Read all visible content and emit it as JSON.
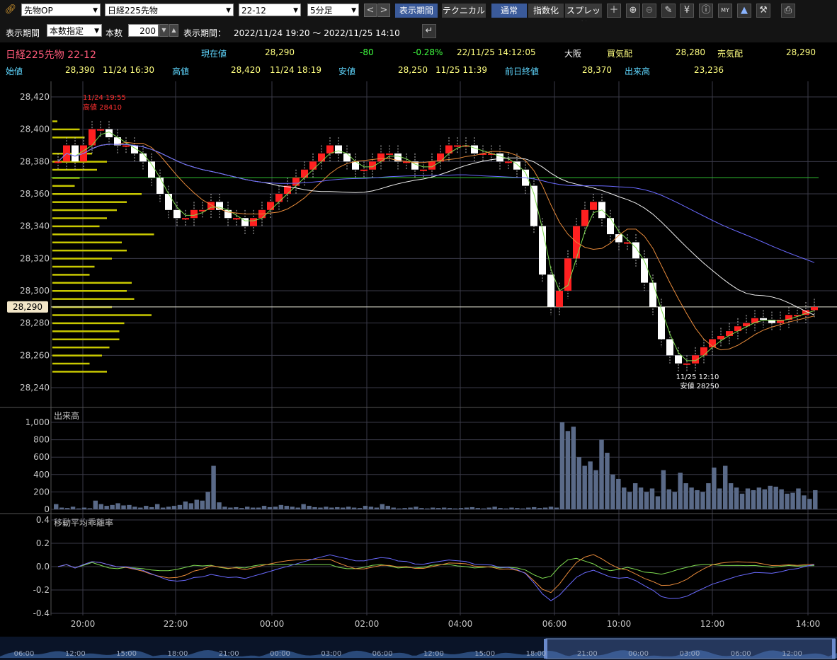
{
  "toolbar": {
    "market_select": "先物OP",
    "instrument_select": "日経225先物",
    "contract_select": "22-12",
    "interval_select": "5分足",
    "prev_label": "<",
    "next_label": ">",
    "period_tab": "表示期間",
    "technical_tab": "テクニカル",
    "mode_normal": "通常",
    "mode_index": "指数化",
    "mode_spread": "スプレッド"
  },
  "period_bar": {
    "label": "表示期間",
    "mode_select": "本数指定",
    "count_label": "本数",
    "count_value": "200",
    "range_label": "表示期間：",
    "range_value": "2022/11/24 19:20 ～ 2022/11/25 14:10"
  },
  "quote": {
    "name": "日経225先物 22-12",
    "current_label": "現在値",
    "current": "28,290",
    "change": "-80",
    "change_pct": "-0.28%",
    "datetime": "22/11/25  14:12:05",
    "exchange": "大阪",
    "bid_label": "買気配",
    "bid": "28,280",
    "ask_label": "売気配",
    "ask": "28,290",
    "open_label": "始値",
    "open": "28,390",
    "open_time": "11/24  16:30",
    "high_label": "高値",
    "high": "28,420",
    "high_time": "11/24  18:19",
    "low_label": "安値",
    "low": "28,250",
    "low_time": "11/25  11:39",
    "prev_close_label": "前日終値",
    "prev_close": "28,370",
    "volume_label": "出来高",
    "volume": "23,236"
  },
  "colors": {
    "up": "#ff2020",
    "down": "#ffffff",
    "ma_short": "#7fdc50",
    "ma_mid": "#e88a3a",
    "ma_long": "#f0f0f0",
    "ma_longest": "#6a6aff",
    "prev_close_line": "#30c030",
    "volume_bar": "#5a6a88",
    "price_profile": "#c8c800"
  },
  "chart_data": [
    {
      "type": "candlestick",
      "title": "",
      "ylim": [
        28240,
        28420
      ],
      "yticks": [
        "28,420",
        "28,400",
        "28,380",
        "28,360",
        "28,340",
        "28,320",
        "28,300",
        "28,280",
        "28,260",
        "28,240"
      ],
      "current_price_tag": "28,290",
      "prev_close": 28370,
      "high_annotation": {
        "time": "11/24 19:55",
        "label": "高値 28410"
      },
      "low_annotation": {
        "time": "11/25 12:10",
        "label": "安値 28250"
      },
      "close_series": [
        28380,
        28390,
        28380,
        28390,
        28400,
        28400,
        28395,
        28390,
        28390,
        28385,
        28380,
        28370,
        28360,
        28350,
        28345,
        28345,
        28350,
        28350,
        28355,
        28350,
        28345,
        28345,
        28340,
        28345,
        28350,
        28355,
        28360,
        28365,
        28370,
        28375,
        28380,
        28385,
        28390,
        28385,
        28380,
        28375,
        28375,
        28380,
        28385,
        28385,
        28380,
        28380,
        28375,
        28375,
        28380,
        28385,
        28390,
        28390,
        28390,
        28385,
        28385,
        28385,
        28380,
        28380,
        28375,
        28365,
        28340,
        28310,
        28290,
        28300,
        28320,
        28340,
        28350,
        28355,
        28345,
        28335,
        28330,
        28330,
        28320,
        28305,
        28290,
        28270,
        28260,
        28255,
        28255,
        28260,
        28265,
        28270,
        28272,
        28275,
        28278,
        28280,
        28283,
        28282,
        28280,
        28282,
        28285,
        28285,
        28288,
        28290
      ],
      "volume_profile_rows": [
        28405,
        28400,
        28395,
        28385,
        28380,
        28375,
        28370,
        28365,
        28360,
        28355,
        28350,
        28345,
        28340,
        28335,
        28330,
        28325,
        28320,
        28315,
        28310,
        28305,
        28300,
        28295,
        28290,
        28285,
        28280,
        28275,
        28270,
        28265,
        28260,
        28255,
        28250
      ],
      "volume_profile_values": [
        10,
        55,
        65,
        80,
        110,
        90,
        55,
        45,
        180,
        150,
        130,
        110,
        95,
        205,
        140,
        150,
        120,
        85,
        75,
        160,
        150,
        165,
        120,
        200,
        145,
        135,
        135,
        115,
        100,
        75,
        110
      ]
    },
    {
      "type": "bar",
      "title": "出来高",
      "ylim": [
        0,
        1000
      ],
      "yticks": [
        "1,000",
        "800",
        "600",
        "400",
        "200",
        "0"
      ],
      "values": [
        60,
        20,
        15,
        30,
        10,
        20,
        12,
        100,
        60,
        40,
        50,
        70,
        45,
        50,
        30,
        20,
        40,
        25,
        60,
        20,
        30,
        40,
        50,
        90,
        70,
        110,
        100,
        200,
        500,
        80,
        30,
        20,
        25,
        15,
        30,
        20,
        20,
        40,
        25,
        30,
        50,
        40,
        30,
        20,
        60,
        40,
        25,
        20,
        30,
        20,
        25,
        20,
        30,
        20,
        15,
        40,
        30,
        20,
        60,
        40,
        20,
        10,
        15,
        20,
        30,
        15,
        10,
        20,
        15,
        20,
        15,
        10,
        15,
        20,
        25,
        15,
        10,
        20,
        30,
        15,
        10,
        20,
        15,
        10,
        20,
        25,
        15,
        20,
        30,
        20,
        1000,
        900,
        950,
        600,
        500,
        550,
        450,
        800,
        650,
        400,
        350,
        250,
        200,
        300,
        250,
        200,
        240,
        150,
        450,
        230,
        200,
        420,
        300,
        250,
        220,
        200,
        300,
        480,
        240,
        500,
        300,
        250,
        180,
        240,
        220,
        250,
        230,
        270,
        260,
        230,
        180,
        190,
        240,
        160,
        120,
        220
      ]
    },
    {
      "type": "line",
      "title": "移動平均乖離率",
      "ylim": [
        -0.4,
        0.4
      ],
      "yticks": [
        "0.4",
        "0.2",
        "0.0",
        "-0.2",
        "-0.4"
      ]
    }
  ],
  "time_axis": [
    "20:00",
    "22:00",
    "00:00",
    "02:00",
    "04:00",
    "06:00",
    "10:00",
    "12:00",
    "14:00"
  ],
  "navigator_axis": [
    "06:00",
    "12:00",
    "15:00",
    "18:00",
    "21:00",
    "00:00",
    "03:00",
    "06:00",
    "12:00",
    "15:00",
    "18:00",
    "21:00",
    "00:00",
    "03:00",
    "06:00",
    "12:00"
  ]
}
